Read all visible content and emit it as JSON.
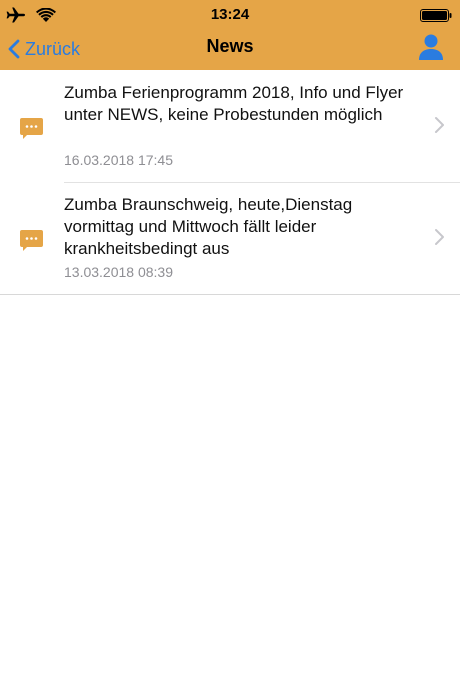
{
  "status": {
    "time": "13:24",
    "icons": [
      "airplane-icon",
      "wifi-icon",
      "battery-icon"
    ]
  },
  "nav": {
    "back_label": "Zurück",
    "title": "News",
    "right_icon": "person-icon"
  },
  "colors": {
    "header_bg": "#E5A547",
    "accent": "#2A7CE0",
    "icon_bubble": "#E5A547",
    "secondary_text": "#8E8E93"
  },
  "news": {
    "items": [
      {
        "title": "Zumba Ferienprogramm 2018, Info und Flyer unter NEWS, keine Probestunden möglich",
        "date": "16.03.2018 17:45",
        "icon": "message-bubble-icon"
      },
      {
        "title": "Zumba Braunschweig, heute,Dienstag vormittag und Mittwoch fällt leider krankheitsbedingt aus",
        "date": "13.03.2018 08:39",
        "icon": "message-bubble-icon"
      }
    ]
  }
}
